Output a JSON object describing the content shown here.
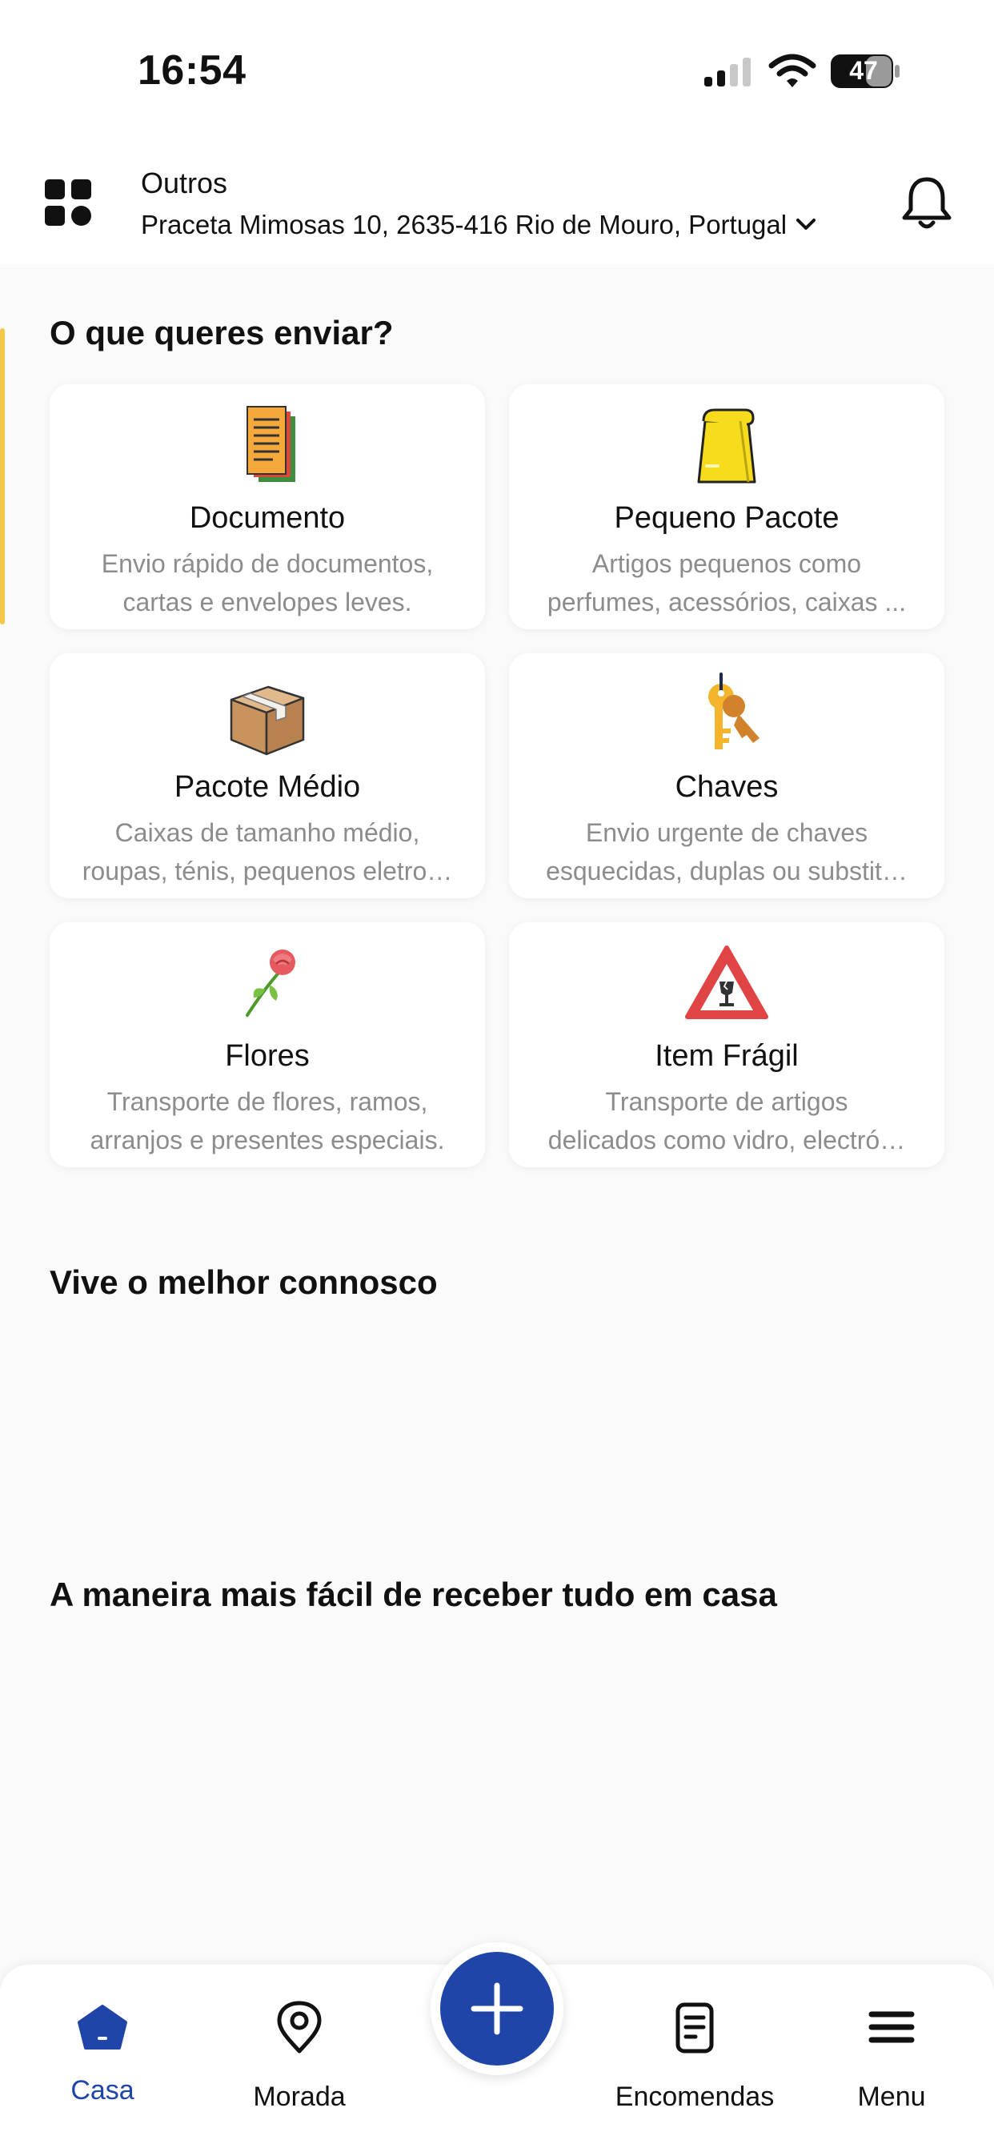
{
  "status_bar": {
    "time": "16:54",
    "battery": "47"
  },
  "header": {
    "address_type": "Outros",
    "address": "Praceta Mimosas 10, 2635-416 Rio de Mouro, Portugal"
  },
  "sections": {
    "send_title": "O que queres enviar?",
    "promo_title": "Vive o melhor connosco",
    "easy_title": "A maneira mais fácil de receber tudo em casa"
  },
  "categories": [
    {
      "title": "Documento",
      "desc1": "Envio rápido de documentos,",
      "desc2": "cartas e envelopes leves.",
      "icon": "document-icon"
    },
    {
      "title": "Pequeno Pacote",
      "desc1": "Artigos pequenos como",
      "desc2": "perfumes, acessórios, caixas ...",
      "icon": "paper-bag-icon"
    },
    {
      "title": "Pacote Médio",
      "desc1": "Caixas de tamanho médio,",
      "desc2": "roupas, ténis, pequenos eletro…",
      "icon": "box-icon"
    },
    {
      "title": "Chaves",
      "desc1": "Envio urgente de chaves",
      "desc2": "esquecidas, duplas ou substit…",
      "icon": "keys-icon"
    },
    {
      "title": "Flores",
      "desc1": "Transporte de flores, ramos,",
      "desc2": "arranjos e presentes especiais.",
      "icon": "rose-icon"
    },
    {
      "title": "Item Frágil",
      "desc1": "Transporte de artigos",
      "desc2": "delicados como vidro, electró…",
      "icon": "fragile-icon"
    }
  ],
  "bottom_nav": {
    "home": "Casa",
    "address": "Morada",
    "orders": "Encomendas",
    "menu": "Menu",
    "active": "Casa"
  },
  "colors": {
    "primary": "#1f45a8",
    "background": "#fafafa",
    "muted_text": "#8c8c8c"
  }
}
